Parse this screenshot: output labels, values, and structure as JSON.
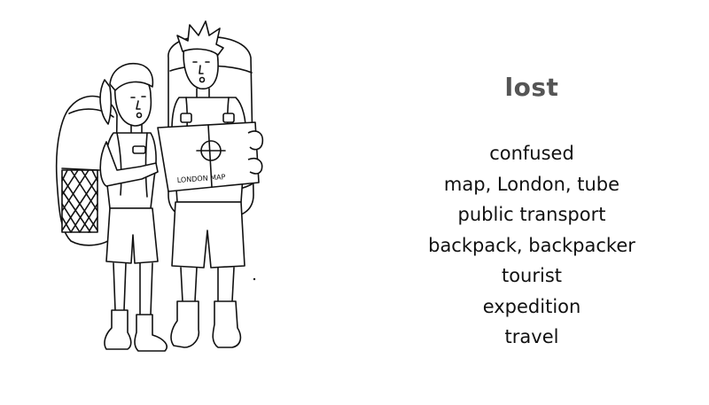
{
  "title": "lost",
  "keywords": [
    "confused",
    "map, London, tube",
    "public transport",
    "backpack, backpacker",
    "tourist",
    "expedition",
    "travel"
  ],
  "illustration": {
    "description_icon": "backpackers-with-map-illustration",
    "map_text": "LONDON MAP"
  }
}
